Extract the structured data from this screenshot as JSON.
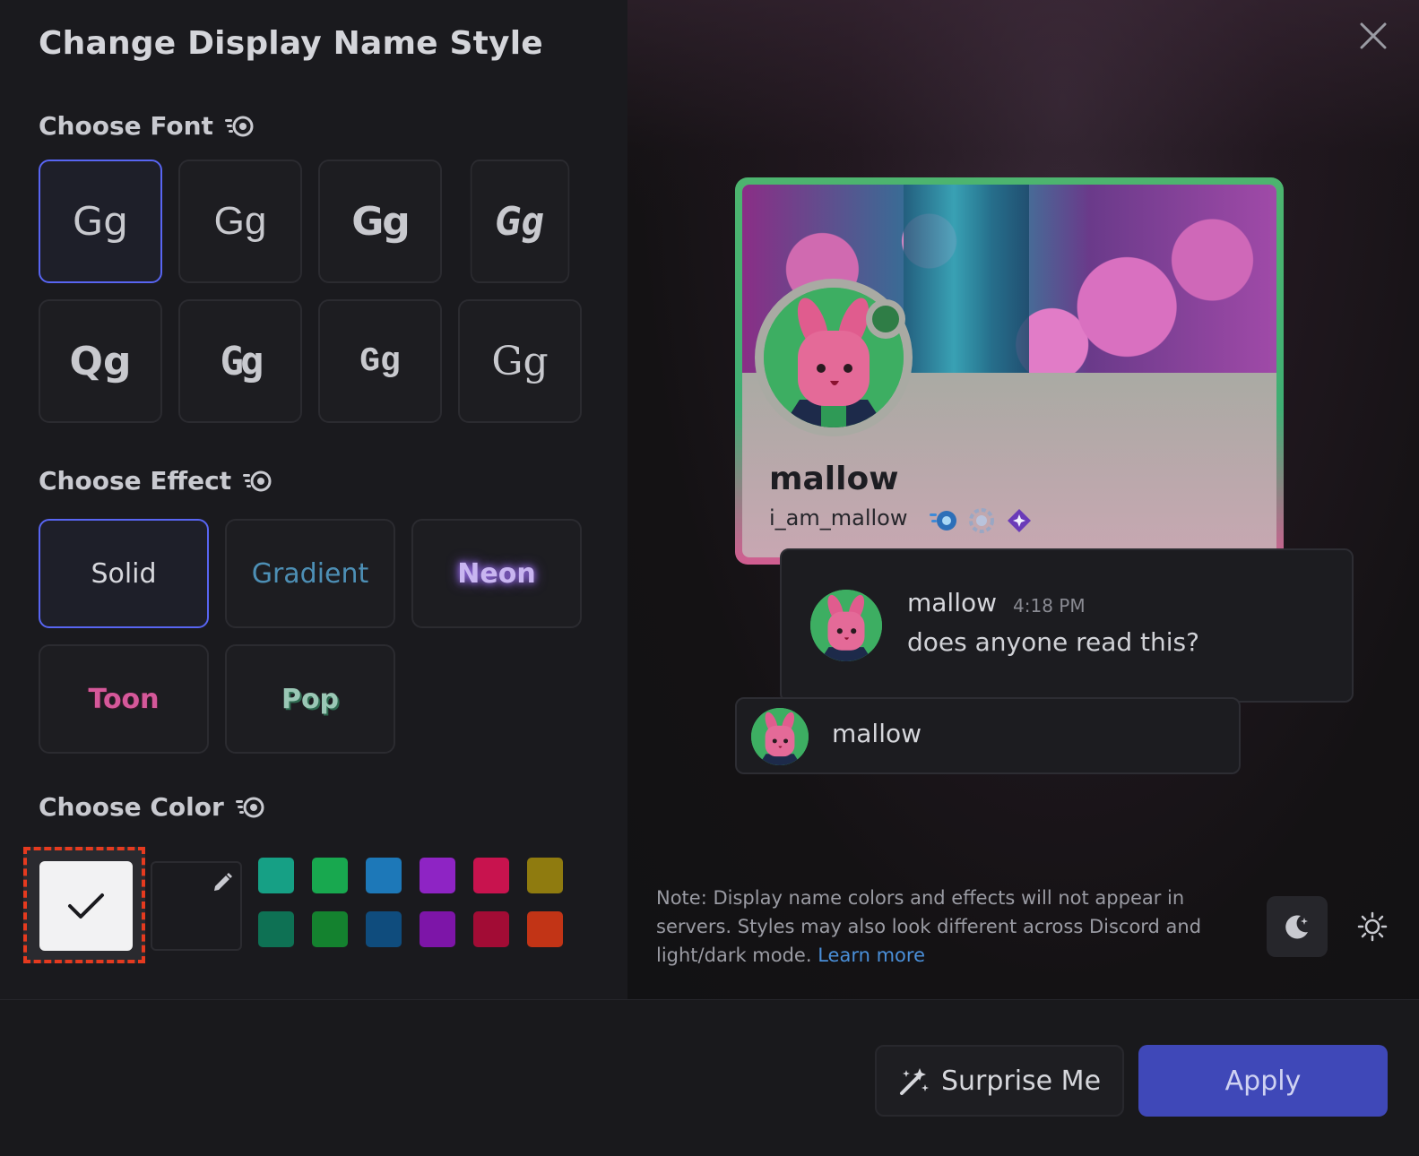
{
  "dialog": {
    "title": "Change Display Name Style",
    "close_icon": "close-icon"
  },
  "font_section": {
    "heading": "Choose Font",
    "nitro_icon": "nitro-icon",
    "fonts": [
      {
        "sample": "Gg",
        "selected": true
      },
      {
        "sample": "Gg",
        "selected": false
      },
      {
        "sample": "Gg",
        "selected": false
      },
      {
        "sample": "Gg",
        "selected": false
      },
      {
        "sample": "Qg",
        "selected": false
      },
      {
        "sample": "Gg",
        "selected": false
      },
      {
        "sample": "Gg",
        "selected": false
      },
      {
        "sample": "Gg",
        "selected": false
      }
    ]
  },
  "effect_section": {
    "heading": "Choose Effect",
    "nitro_icon": "nitro-icon",
    "effects": [
      {
        "label": "Solid",
        "selected": true
      },
      {
        "label": "Gradient",
        "selected": false
      },
      {
        "label": "Neon",
        "selected": false
      },
      {
        "label": "Toon",
        "selected": false
      },
      {
        "label": "Pop",
        "selected": false
      }
    ]
  },
  "color_section": {
    "heading": "Choose Color",
    "nitro_icon": "nitro-icon",
    "selected_color": "#f2f2f3",
    "selected_icon": "checkmark-icon",
    "custom_icon": "pencil-icon",
    "swatches": [
      "#16a085",
      "#18a84f",
      "#1d78b8",
      "#8e24c4",
      "#c8134e",
      "#8f7b0f",
      "#0e7154",
      "#14822f",
      "#0f4c7d",
      "#7d15a8",
      "#a20c35",
      "#c23416"
    ]
  },
  "preview": {
    "profile": {
      "display_name": "mallow",
      "username": "i_am_mallow",
      "status": "online",
      "badges": [
        "nitro-badge-icon",
        "boost-badge-icon",
        "quest-badge-icon"
      ]
    },
    "message": {
      "author": "mallow",
      "time": "4:18 PM",
      "text": "does anyone read this?"
    },
    "member": {
      "name": "mallow"
    }
  },
  "note": {
    "text": "Note: Display name colors and effects will not appear in servers. Styles may also look different across Discord and light/dark mode.",
    "link": "Learn more"
  },
  "theme": {
    "dark_icon": "moon-icon",
    "light_icon": "sun-icon",
    "active": "dark"
  },
  "footer": {
    "surprise_label": "Surprise Me",
    "surprise_icon": "magic-wand-icon",
    "apply_label": "Apply"
  }
}
